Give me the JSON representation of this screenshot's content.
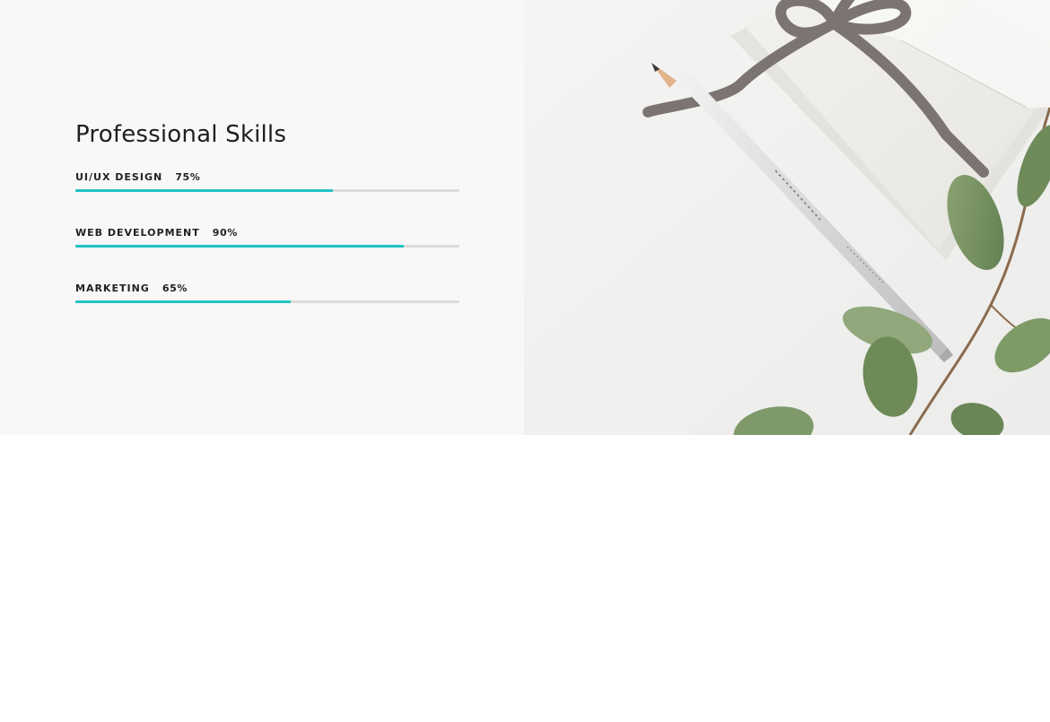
{
  "skills": {
    "title": "Professional Skills",
    "items": [
      {
        "label": "UI/UX DESIGN",
        "percent_text": "75%",
        "value": 0.67
      },
      {
        "label": "WEB DEVELOPMENT",
        "percent_text": "90%",
        "value": 0.855
      },
      {
        "label": "MARKETING",
        "percent_text": "65%",
        "value": 0.56
      }
    ]
  },
  "colors": {
    "accent": "#21c2c3",
    "track": "#dcdcdc",
    "section_bg": "#f8f8f8",
    "page_bg": "#ffffff"
  },
  "image": {
    "description_icon": "desk-photo-icon"
  }
}
